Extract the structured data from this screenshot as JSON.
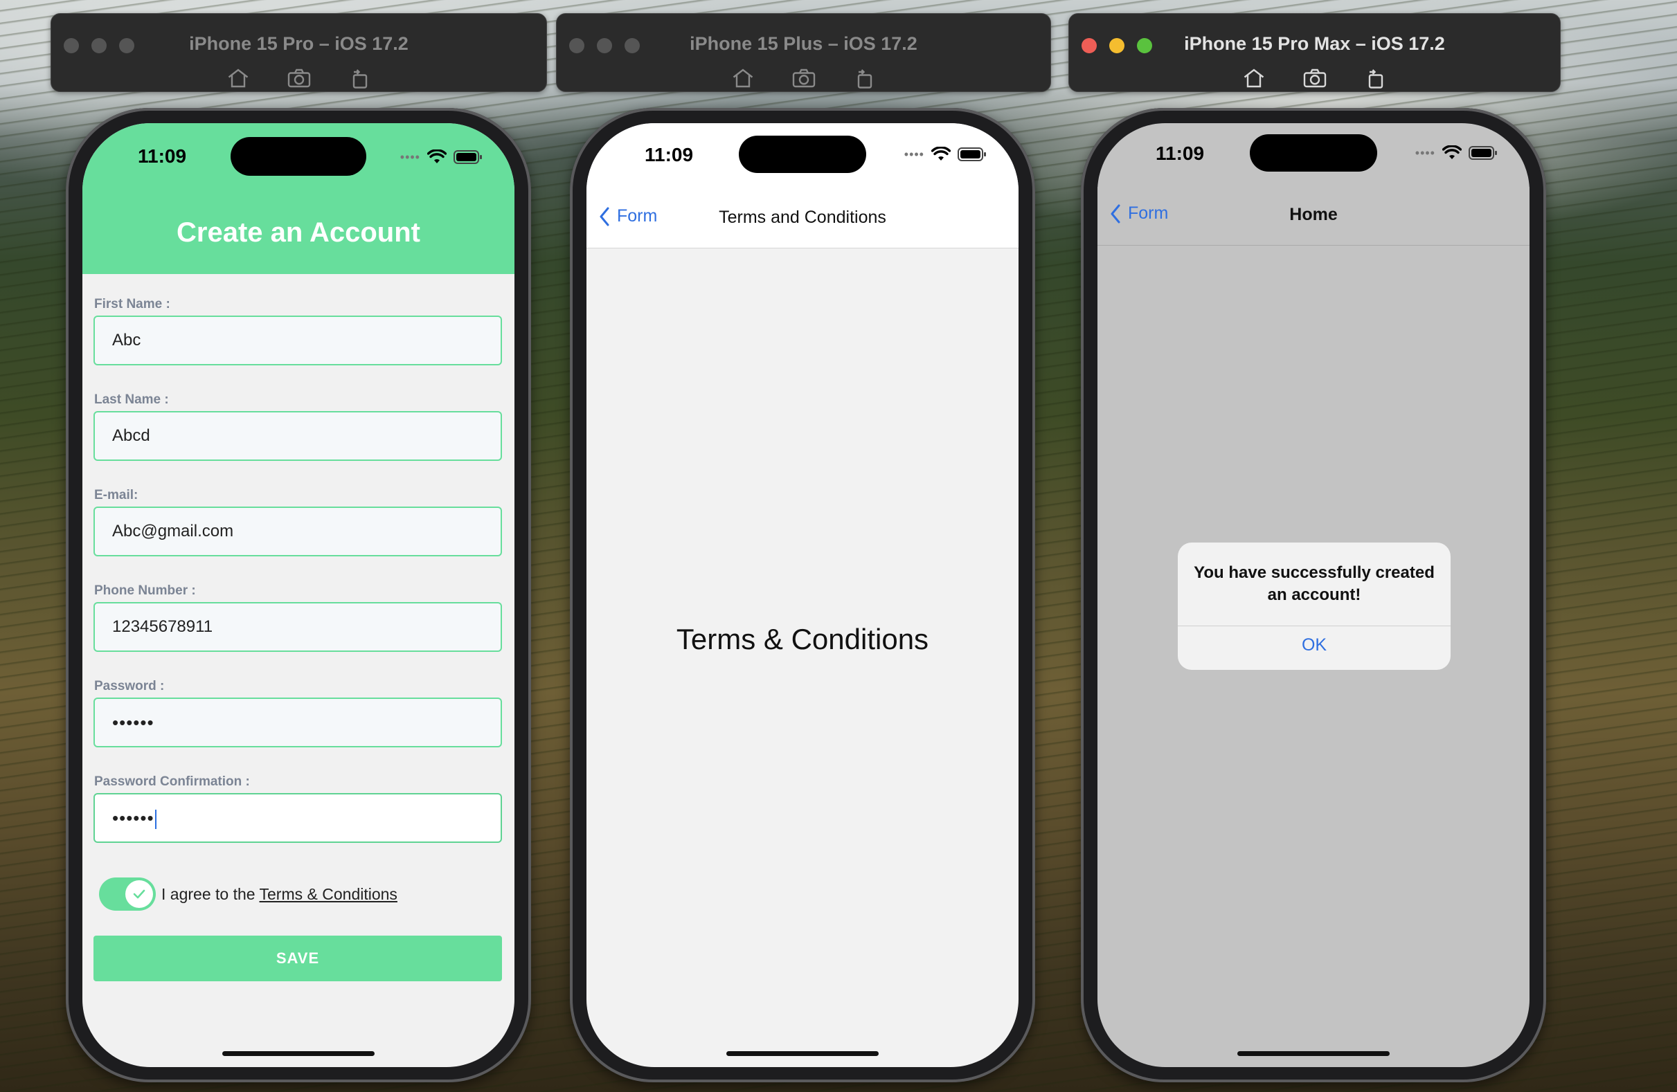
{
  "simulators": [
    {
      "title": "iPhone 15 Pro – iOS 17.2",
      "active": false
    },
    {
      "title": "iPhone 15 Plus – iOS 17.2",
      "active": false
    },
    {
      "title": "iPhone 15 Pro Max – iOS 17.2",
      "active": true
    }
  ],
  "toolbar_icons": [
    "home-icon",
    "screenshot-icon",
    "rotate-icon"
  ],
  "status": {
    "time": "11:09",
    "signal_dots": "••••"
  },
  "colors": {
    "accent_green": "#67de9c",
    "link_blue": "#2f6fe0"
  },
  "form_screen": {
    "header_title": "Create an Account",
    "fields": [
      {
        "label": "First Name :",
        "value": "Abc"
      },
      {
        "label": "Last Name :",
        "value": "Abcd"
      },
      {
        "label": "E-mail:",
        "value": "Abc@gmail.com"
      },
      {
        "label": "Phone Number :",
        "value": "12345678911"
      },
      {
        "label": "Password :",
        "value": "••••••"
      },
      {
        "label": "Password Confirmation :",
        "value": "••••••"
      }
    ],
    "agree_prefix": "I agree to the ",
    "agree_link": "Terms & Conditions",
    "toggle_on": true,
    "save_label": "SAVE"
  },
  "terms_screen": {
    "back_label": "Form",
    "nav_title": "Terms and Conditions",
    "body_text": "Terms & Conditions"
  },
  "home_screen": {
    "back_label": "Form",
    "nav_title": "Home",
    "alert_message": "You have successfully created an account!",
    "alert_ok": "OK"
  }
}
